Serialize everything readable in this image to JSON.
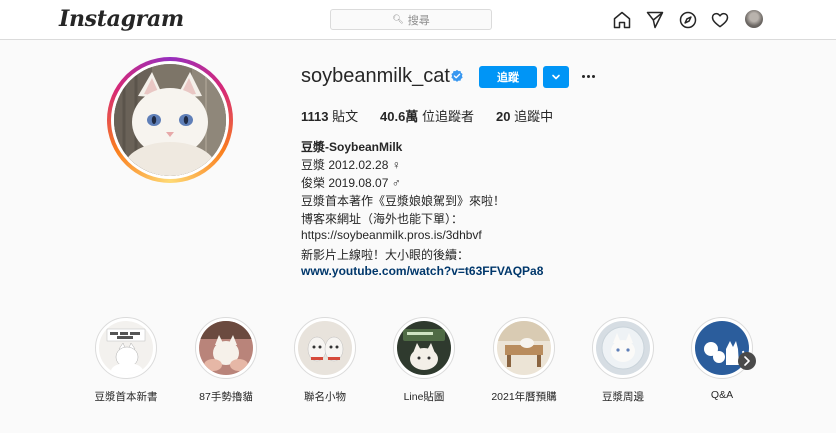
{
  "topbar": {
    "logo": "Instagram",
    "search_placeholder": "搜尋"
  },
  "profile": {
    "username": "soybeanmilk_cat",
    "follow_label": "追蹤",
    "stats": {
      "posts_count": "1113",
      "posts_label": "貼文",
      "followers_count": "40.6萬",
      "followers_label": "位追蹤者",
      "following_count": "20",
      "following_label": "追蹤中"
    },
    "bio": {
      "name": "豆漿-SoybeanMilk",
      "lines": [
        "豆漿 2012.02.28 ♀",
        "俊榮 2019.08.07 ♂",
        "豆漿首本著作《豆漿娘娘駕到》來啦！",
        "博客來網址（海外也能下單）：",
        "https://soybeanmilk.pros.is/3dhbvf",
        "新影片上線啦！大小眼的後續："
      ],
      "link": "www.youtube.com/watch?v=t63FFVAQPa8"
    }
  },
  "highlights": [
    {
      "label": "豆漿首本新書"
    },
    {
      "label": "87手勢擼貓"
    },
    {
      "label": "聯名小物"
    },
    {
      "label": "Line貼圖"
    },
    {
      "label": "2021年曆預購"
    },
    {
      "label": "豆漿周邊"
    },
    {
      "label": "Q&A"
    }
  ],
  "colors": {
    "accent": "#0095f6",
    "link": "#00376b",
    "text": "#262626",
    "muted": "#8e8e8e",
    "border": "#dbdbdb"
  },
  "icons": [
    "search-icon",
    "home-icon",
    "direct-message-icon",
    "explore-icon",
    "heart-icon",
    "verified-badge-icon",
    "chevron-down-icon",
    "more-options-icon",
    "chevron-right-icon"
  ]
}
